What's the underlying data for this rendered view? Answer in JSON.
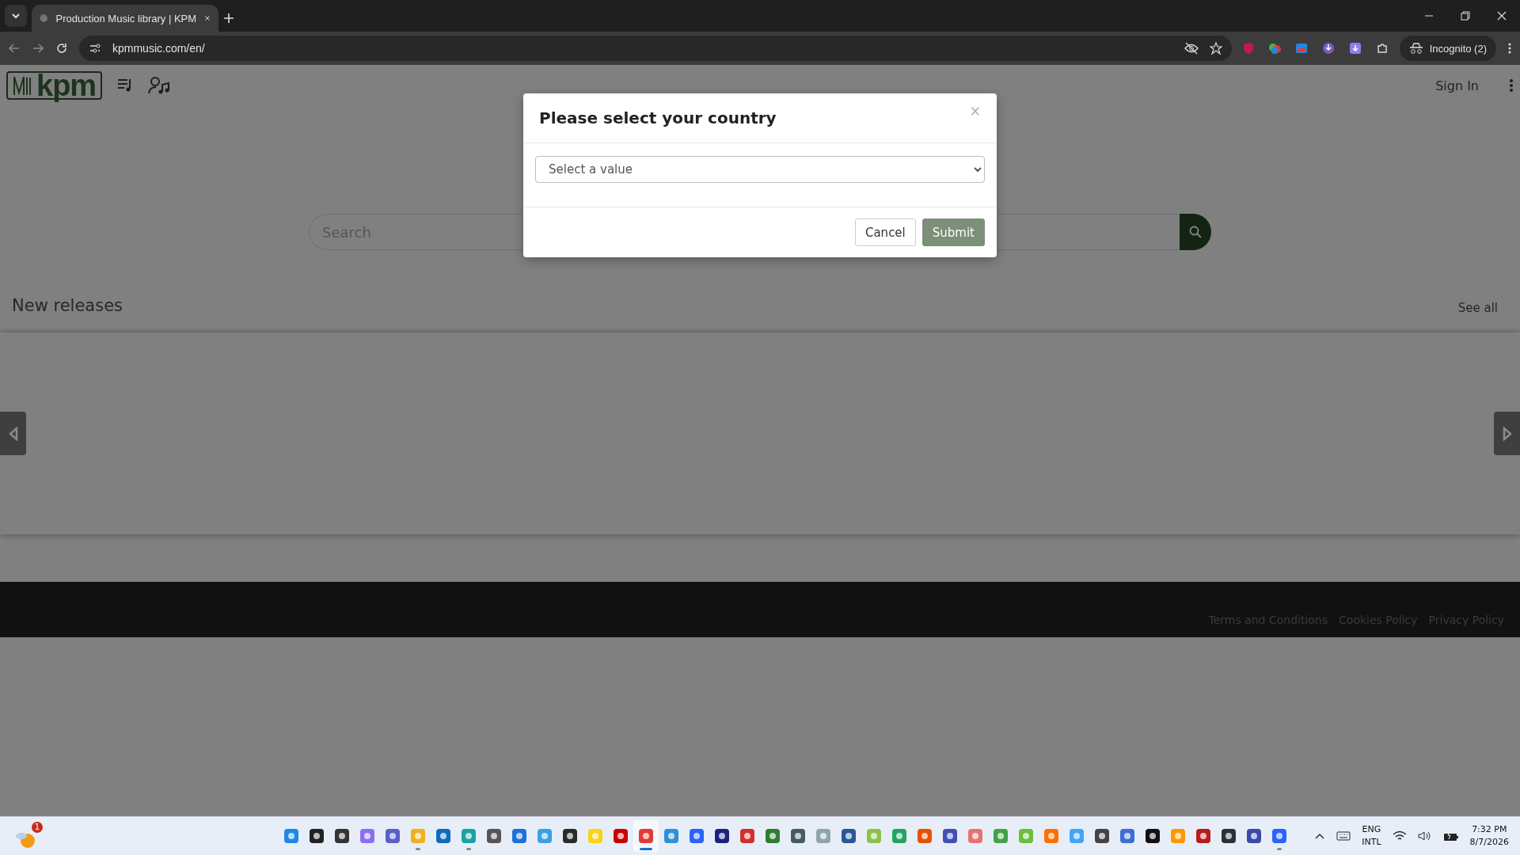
{
  "browser": {
    "tab_title": "Production Music library | KPM",
    "url": "kpmmusic.com/en/",
    "profile": "Incognito (2)"
  },
  "site": {
    "logo": "kpm",
    "sign_in": "Sign In",
    "search": {
      "placeholder": "Search"
    },
    "section_title": "New releases",
    "see_all": "See all",
    "footer_links": [
      "Terms and Conditions",
      "Cookies Policy",
      "Privacy Policy"
    ]
  },
  "dialog": {
    "title": "Please select your country",
    "close": "×",
    "select": {
      "placeholder": "Select a value"
    },
    "buttons": [
      {
        "label": "Cancel",
        "kind": "secondary"
      },
      {
        "label": "Submit",
        "kind": "primary"
      }
    ]
  },
  "taskbar": {
    "weather_badge": "1",
    "apps": [
      {
        "running": false,
        "selected": false
      },
      {
        "running": false,
        "selected": false
      },
      {
        "running": false,
        "selected": false
      },
      {
        "running": false,
        "selected": false
      },
      {
        "running": false,
        "selected": false
      },
      {
        "running": true,
        "selected": false
      },
      {
        "running": false,
        "selected": false
      },
      {
        "running": true,
        "selected": false
      },
      {
        "running": false,
        "selected": false
      },
      {
        "running": false,
        "selected": false
      },
      {
        "running": false,
        "selected": false
      },
      {
        "running": false,
        "selected": false
      },
      {
        "running": false,
        "selected": false
      },
      {
        "running": false,
        "selected": false
      },
      {
        "running": true,
        "selected": true
      },
      {
        "running": false,
        "selected": false
      },
      {
        "running": false,
        "selected": false
      },
      {
        "running": false,
        "selected": false
      },
      {
        "running": false,
        "selected": false
      },
      {
        "running": false,
        "selected": false
      },
      {
        "running": false,
        "selected": false
      },
      {
        "running": false,
        "selected": false
      },
      {
        "running": false,
        "selected": false
      },
      {
        "running": false,
        "selected": false
      },
      {
        "running": false,
        "selected": false
      },
      {
        "running": false,
        "selected": false
      },
      {
        "running": false,
        "selected": false
      },
      {
        "running": false,
        "selected": false
      },
      {
        "running": false,
        "selected": false
      },
      {
        "running": false,
        "selected": false
      },
      {
        "running": false,
        "selected": false
      },
      {
        "running": false,
        "selected": false
      },
      {
        "running": false,
        "selected": false
      },
      {
        "running": false,
        "selected": false
      },
      {
        "running": false,
        "selected": false
      },
      {
        "running": false,
        "selected": false
      },
      {
        "running": false,
        "selected": false
      },
      {
        "running": false,
        "selected": false
      },
      {
        "running": false,
        "selected": false
      },
      {
        "running": true,
        "selected": false
      }
    ],
    "language": "ENG",
    "layout": "INTL",
    "time": "7:32 PM",
    "date": "8/7/2026"
  }
}
